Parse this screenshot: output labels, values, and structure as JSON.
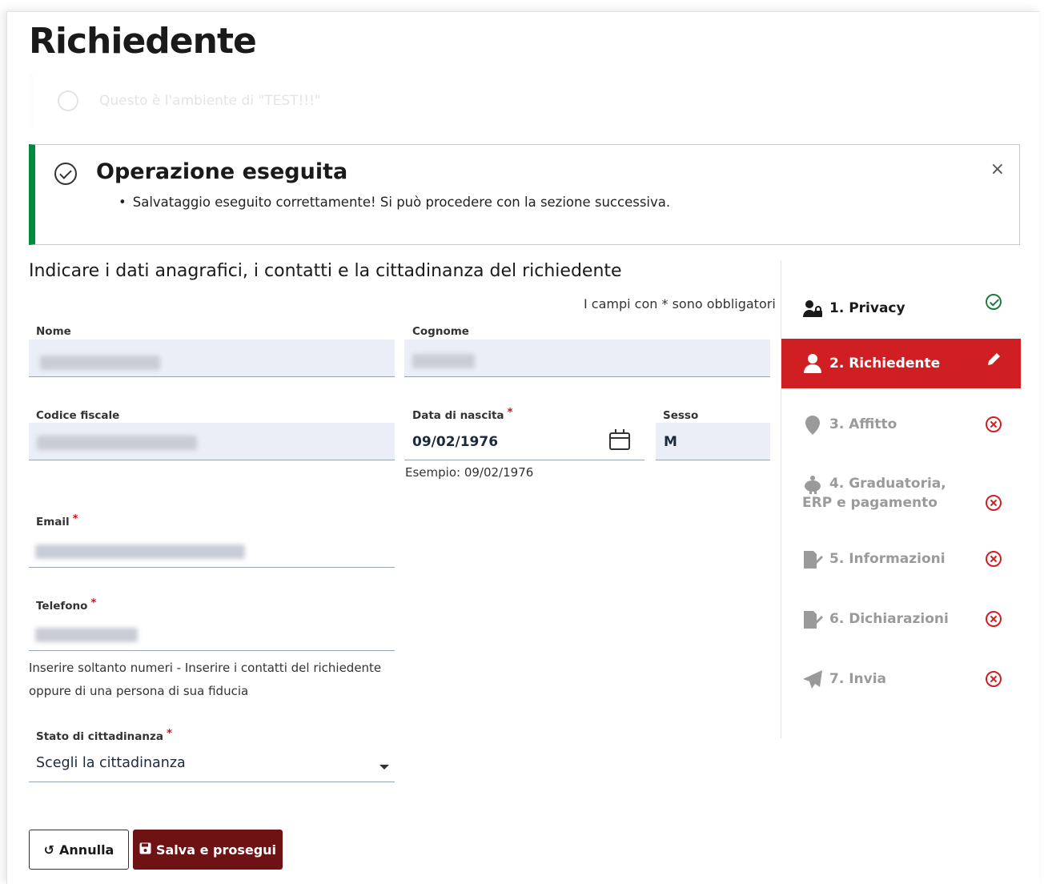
{
  "page": {
    "title": "Richiedente"
  },
  "faded_notice": {
    "text": "Questo è l'ambiente di \"TEST!!!\""
  },
  "alert": {
    "title": "Operazione eseguita",
    "message": "Salvataggio eseguito correttamente! Si può procedere con la sezione successiva.",
    "close_label": "×"
  },
  "form": {
    "intro": "Indicare i dati anagrafici, i contatti e la cittadinanza del richiedente",
    "required_note": "I campi con * sono obbligatori",
    "required_marker": "*",
    "nome": {
      "label": "Nome"
    },
    "cognome": {
      "label": "Cognome"
    },
    "codice_fiscale": {
      "label": "Codice fiscale"
    },
    "data_nascita": {
      "label": "Data di nascita",
      "value": "09/02/1976",
      "hint": "Esempio: 09/02/1976"
    },
    "sesso": {
      "label": "Sesso",
      "value": "M"
    },
    "email": {
      "label": "Email"
    },
    "telefono": {
      "label": "Telefono",
      "hint_line1": "Inserire soltanto numeri - Inserire i contatti del richiedente",
      "hint_line2": "oppure di una persona di sua fiducia"
    },
    "cittadinanza": {
      "label": "Stato di cittadinanza",
      "value": "Scegli la cittadinanza"
    }
  },
  "buttons": {
    "annulla": "Annulla",
    "salva": "Salva e prosegui"
  },
  "steps": [
    {
      "label": "1. Privacy",
      "icon": "user-lock-icon",
      "status": "completed"
    },
    {
      "label": "2. Richiedente",
      "icon": "user-icon",
      "status": "editing"
    },
    {
      "label": "3. Affitto",
      "icon": "map-marker-icon",
      "status": "error"
    },
    {
      "label": "4. Graduatoria, ERP e pagamento",
      "icon": "piggy-bank-icon",
      "status": "error"
    },
    {
      "label": "5. Informazioni",
      "icon": "file-signature-icon",
      "status": "error"
    },
    {
      "label": "6. Dichiarazioni",
      "icon": "file-signature-icon",
      "status": "error"
    },
    {
      "label": "7. Invia",
      "icon": "paper-plane-icon",
      "status": "error"
    }
  ],
  "colors": {
    "success": "#008a3e",
    "active_step": "#d01f23",
    "primary_button": "#6e1214",
    "required": "#d1111c"
  }
}
